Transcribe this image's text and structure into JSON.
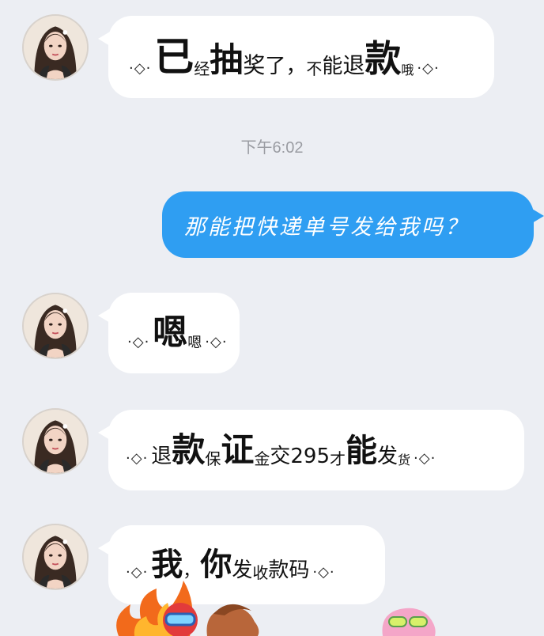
{
  "messages": [
    {
      "direction": "incoming",
      "segments": [
        "已",
        "经",
        "抽",
        "奖",
        "了，",
        "不",
        "能",
        "退",
        "款",
        "哦"
      ],
      "decoration_left": "·◇·",
      "decoration_right": "·◇·"
    },
    {
      "direction": "timestamp",
      "text": "下午6:02"
    },
    {
      "direction": "outgoing",
      "text": "那能把快递单号发给我吗？"
    },
    {
      "direction": "incoming",
      "segments": [
        "嗯",
        "嗯"
      ],
      "decoration_left": "·◇·",
      "decoration_right": "·◇·"
    },
    {
      "direction": "incoming",
      "segments": [
        "退",
        "款",
        "保",
        "证",
        "金",
        "交",
        "295",
        "才",
        "能",
        "发",
        "货"
      ],
      "decoration_left": "·◇·",
      "decoration_right": "·◇·"
    },
    {
      "direction": "incoming",
      "segments": [
        "我",
        "，",
        "你",
        "发",
        "收",
        "款",
        "码"
      ],
      "decoration_left": "·◇·",
      "decoration_right": "·◇·"
    }
  ],
  "colors": {
    "background": "#eceef3",
    "incoming_bubble": "#ffffff",
    "outgoing_bubble": "#2f9ef2",
    "timestamp": "#9a9ca2"
  },
  "icons": {
    "avatar": "contact-avatar-woman-portrait",
    "stickers": "cartoon-sticker-figures"
  }
}
